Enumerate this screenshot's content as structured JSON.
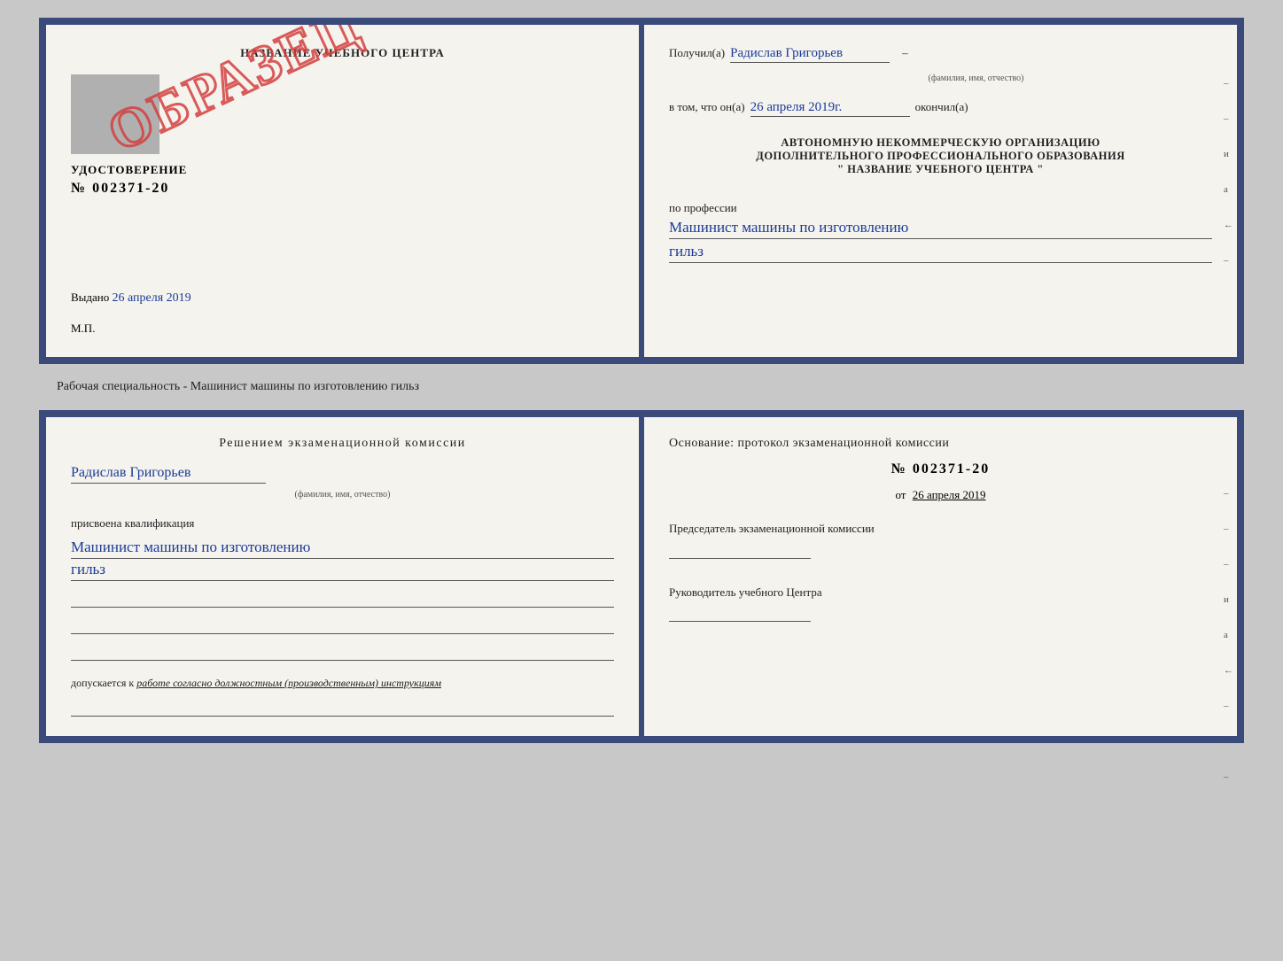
{
  "top_doc": {
    "left": {
      "title": "НАЗВАНИЕ УЧЕБНОГО ЦЕНТРА",
      "cert_label": "УДОСТОВЕРЕНИЕ",
      "cert_number": "№ 002371-20",
      "issued_label": "Выдано",
      "issued_date": "26 апреля 2019",
      "mp_label": "М.П.",
      "stamp_text": "ОБРАЗЕЦ"
    },
    "right": {
      "received_label": "Получил(а)",
      "name_handwritten": "Радислав Григорьев",
      "name_sub": "(фамилия, имя, отчество)",
      "in_that_label": "в том, что он(а)",
      "date_handwritten": "26 апреля 2019г.",
      "finished_label": "окончил(а)",
      "block_line1": "АВТОНОМНУЮ НЕКОММЕРЧЕСКУЮ ОРГАНИЗАЦИЮ",
      "block_line2": "ДОПОЛНИТЕЛЬНОГО ПРОФЕССИОНАЛЬНОГО ОБРАЗОВАНИЯ",
      "block_line3": "\"   НАЗВАНИЕ УЧЕБНОГО ЦЕНТРА   \"",
      "profession_label": "по профессии",
      "profession_handwritten": "Машинист машины по изготовлению",
      "profession_handwritten2": "гильз",
      "side_marks": [
        "–",
        "–",
        "и",
        "а",
        "←",
        "–"
      ]
    }
  },
  "caption": "Рабочая специальность - Машинист машины по изготовлению гильз",
  "bottom_doc": {
    "left": {
      "decision_title": "Решением  экзаменационной  комиссии",
      "name_handwritten": "Радислав Григорьев",
      "name_sub": "(фамилия, имя, отчество)",
      "assigned_label": "присвоена квалификация",
      "qual_handwritten": "Машинист  машины  по  изготовлению",
      "qual_handwritten2": "гильз",
      "допускается_label": "допускается к",
      "допускается_text": "работе согласно должностным (производственным) инструкциям"
    },
    "right": {
      "osnov_label": "Основание:  протокол  экзаменационной  комиссии",
      "protocol_number": "№  002371-20",
      "date_prefix": "от",
      "date_value": "26 апреля 2019",
      "chairman_label": "Председатель экзаменационной комиссии",
      "head_label": "Руководитель учебного Центра",
      "side_marks": [
        "–",
        "–",
        "–",
        "и",
        "а",
        "←",
        "–",
        "–",
        "–"
      ]
    }
  }
}
